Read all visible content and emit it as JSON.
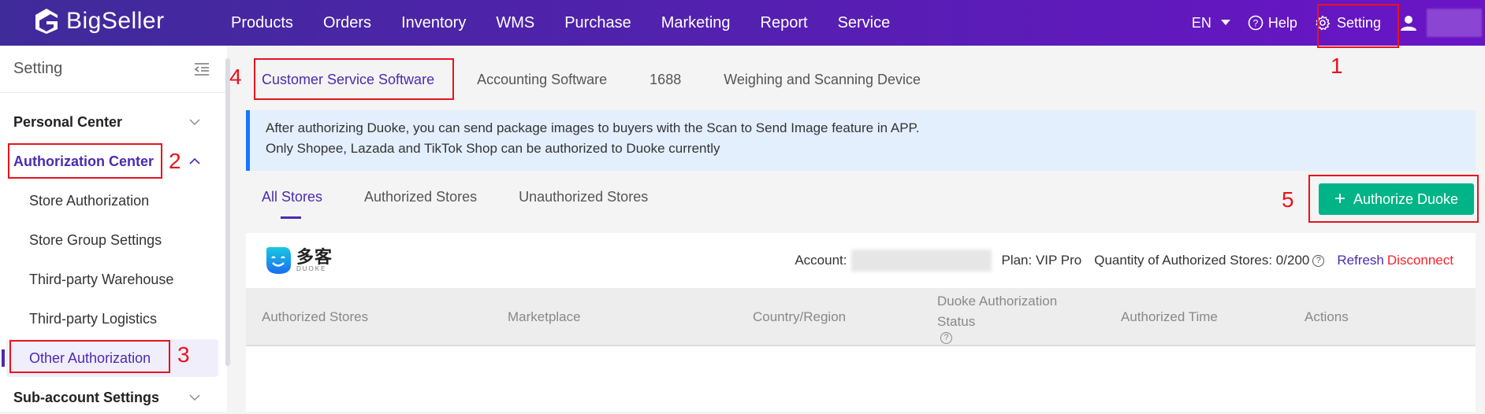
{
  "header": {
    "brand": "BigSeller",
    "nav": [
      "Products",
      "Orders",
      "Inventory",
      "WMS",
      "Purchase",
      "Marketing",
      "Report",
      "Service"
    ],
    "language": "EN",
    "help_label": "Help",
    "setting_label": "Setting"
  },
  "sidebar": {
    "title": "Setting",
    "items": [
      {
        "label": "Personal Center",
        "level": 1,
        "expanded": false
      },
      {
        "label": "Authorization Center",
        "level": 1,
        "expanded": true
      },
      {
        "label": "Store Authorization",
        "level": 2
      },
      {
        "label": "Store Group Settings",
        "level": 2
      },
      {
        "label": "Third-party Warehouse",
        "level": 2
      },
      {
        "label": "Third-party Logistics",
        "level": 2
      },
      {
        "label": "Other Authorization",
        "level": 2,
        "active": true
      },
      {
        "label": "Sub-account Settings",
        "level": 1,
        "expanded": false
      }
    ]
  },
  "tabs": [
    "Customer Service Software",
    "Accounting Software",
    "1688",
    "Weighing and Scanning Device"
  ],
  "active_tab": "Customer Service Software",
  "info": {
    "line1": "After authorizing Duoke, you can send package images to buyers with the Scan to Send Image feature in APP.",
    "line2": "Only Shopee, Lazada and TikTok Shop can be authorized to Duoke currently"
  },
  "store_tabs": [
    "All Stores",
    "Authorized Stores",
    "Unauthorized Stores"
  ],
  "active_store_tab": "All Stores",
  "authorize_button": "Authorize Duoke",
  "card": {
    "logo_cn": "多客",
    "logo_en": "DUOKE",
    "account_label": "Account:",
    "plan": "Plan: VIP Pro",
    "quantity": "Quantity of Authorized Stores: 0/200",
    "refresh": "Refresh",
    "disconnect": "Disconnect"
  },
  "table": {
    "columns": [
      "Authorized Stores",
      "Marketplace",
      "Country/Region",
      "Duoke Authorization Status",
      "Authorized Time",
      "Actions"
    ]
  },
  "annotations": [
    "1",
    "2",
    "3",
    "4",
    "5"
  ],
  "colors": {
    "primary": "#4b2bb0",
    "accent_green": "#00b487",
    "danger": "#f5222d",
    "annotation": "#e8131e"
  }
}
